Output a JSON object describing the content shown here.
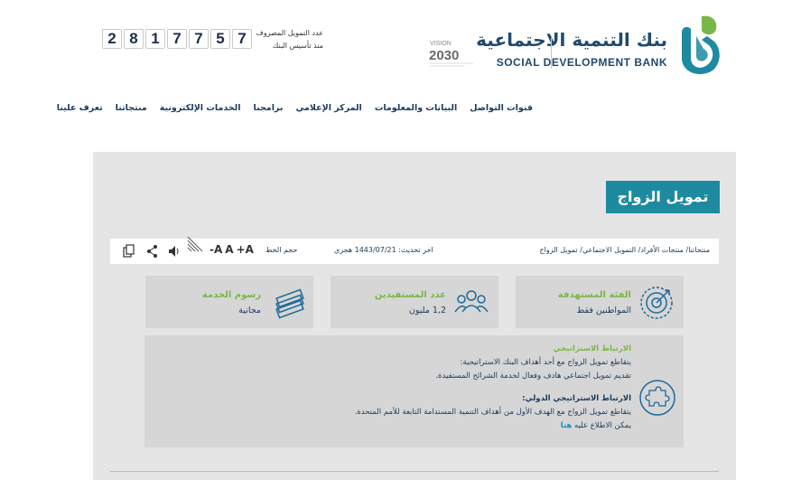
{
  "header": {
    "logo_ar": "بنك التنمية الاجتماعية",
    "logo_en": "SOCIAL DEVELOPMENT BANK",
    "vision_label": "VISION",
    "vision_year": "2030",
    "counter_digits": [
      "2",
      "8",
      "1",
      "7",
      "7",
      "5",
      "7"
    ],
    "counter_label_1": "عدد التمويل المصروف",
    "counter_label_2": "منذ تأسيس البنك"
  },
  "nav": {
    "items": [
      "تعرف علينا",
      "منتجاتنا",
      "الخدمات الإلكترونية",
      "برامجنا",
      "المركز الإعلامي",
      "البيانات والمعلومات",
      "قنوات التواصل"
    ]
  },
  "page": {
    "title": "تمويل الزواج"
  },
  "toolbar": {
    "breadcrumb": "منتجاتنا/ منتجات الأفراد/ التمويل الاجتماعي/ تمويل الزواج",
    "updated": "اخر تحديث: 1443/07/21 هجري",
    "font_size_label": "حجم الخط",
    "font_plus": "+A",
    "font_normal": "A",
    "font_minus": "-A",
    "icons": [
      "contrast-icon",
      "speaker-icon",
      "share-icon",
      "copy-icon"
    ]
  },
  "cards": [
    {
      "title": "الفئة المستهدفة",
      "value": "المواطنين فقط",
      "icon": "target-icon"
    },
    {
      "title": "عدد المستفيدين",
      "value": "1,2 مليون",
      "icon": "users-icon"
    },
    {
      "title": "رسوم الخدمة",
      "value": "مجانية",
      "icon": "money-icon"
    }
  ],
  "strategy": {
    "heading_1": "الارتباط الاستراتيجي",
    "line_1": "يتقاطع تمويل الزواج مع أحد أهداف البنك الاستراتيجية:",
    "line_2": "تقديم تمويل اجتماعي هادف وفعال لخدمة الشرائح المستفيدة.",
    "heading_2": "الارتباط الاستراتيجي الدولي:",
    "line_3": "يتقاطع تمويل الزواج مع الهدف الأول من أهداف التنمية المستدامة التابعة للأمم المتحدة.",
    "line_4": "يمكن الاطلاع عليه",
    "link_text": "هنا",
    "icon": "puzzle-icon"
  },
  "colors": {
    "accent": "#1e8aa0",
    "green": "#7ab648",
    "navy": "#1a3a5c"
  }
}
